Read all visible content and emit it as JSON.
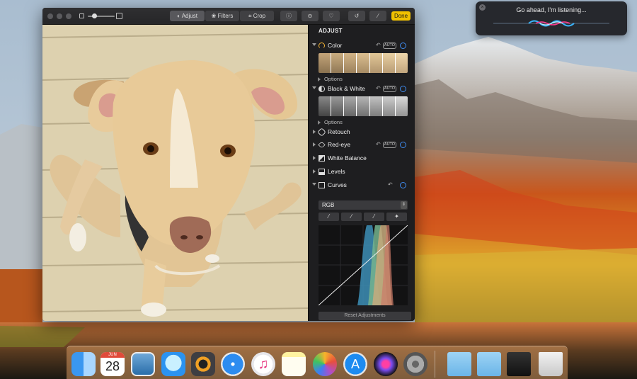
{
  "siri": {
    "message": "Go ahead, I'm listening...",
    "close_icon": "close-icon"
  },
  "toolbar": {
    "tabs": [
      "Adjust",
      "Filters",
      "Crop"
    ],
    "done_label": "Done",
    "icons": [
      "info-icon",
      "hide-icon",
      "heart-icon",
      "rotate-icon",
      "magic-wand-icon"
    ]
  },
  "panel": {
    "title": "ADJUST",
    "auto_label": "AUTO",
    "options_label": "Options",
    "sections": [
      "Color",
      "Black & White",
      "Retouch",
      "Red-eye",
      "White Balance",
      "Levels",
      "Curves"
    ],
    "curves_channel": "RGB",
    "channel_arrow": "⇕",
    "reset_label": "Reset Adjustments"
  },
  "dock": {
    "calendar_month": "JUN",
    "calendar_day": "28",
    "apps": [
      "Finder",
      "Calendar",
      "Preview",
      "Messages",
      "Photo Booth",
      "Safari",
      "iTunes",
      "Notes",
      "Photos",
      "App Store",
      "Siri",
      "System Preferences",
      "Applications",
      "Downloads",
      "Screen Recorder",
      "Trash"
    ]
  },
  "colors": {
    "accent": "#3f8cf0",
    "done": "#f0c000",
    "panel": "#1e1e20"
  }
}
